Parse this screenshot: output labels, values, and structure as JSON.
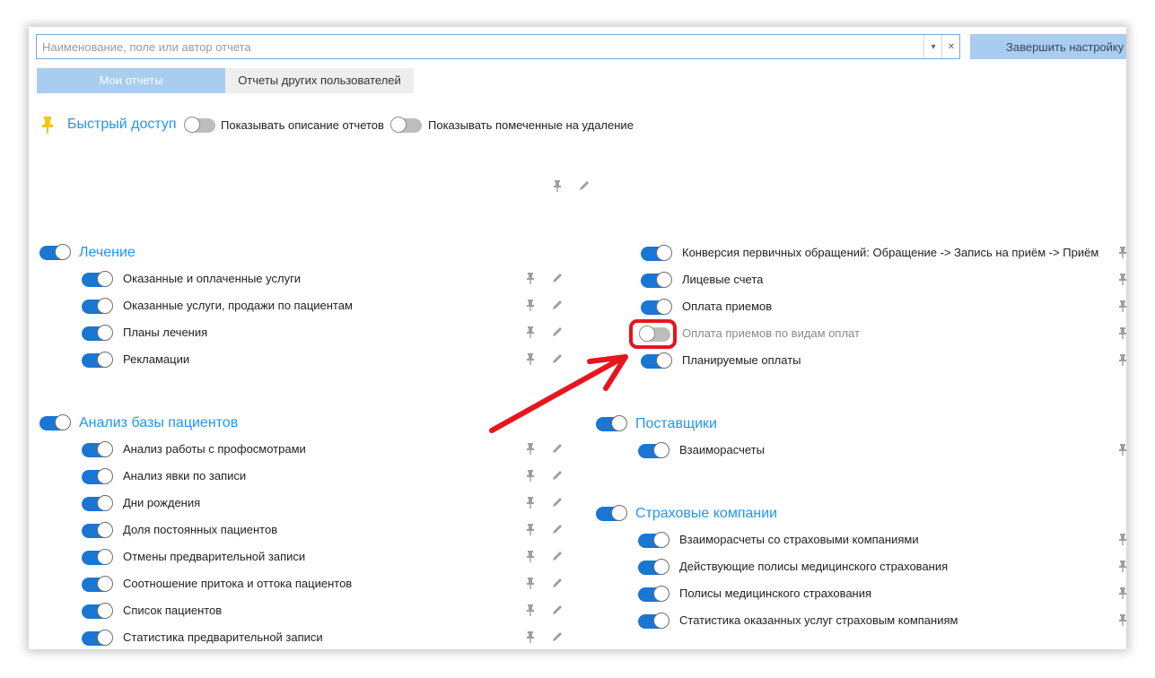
{
  "search": {
    "placeholder": "Наименование, поле или автор отчета",
    "value": ""
  },
  "header": {
    "finish_label": "Завершить настройку"
  },
  "tabs": [
    {
      "label": "Мои отчеты",
      "active": true
    },
    {
      "label": "Отчеты других пользователей",
      "active": false
    }
  ],
  "quick_access": {
    "title": "Быстрый доступ",
    "show_descriptions_label": "Показывать описание отчетов",
    "show_descriptions_on": false,
    "show_deleted_label": "Показывать помеченные на удаление",
    "show_deleted_on": false
  },
  "sections": {
    "lechenie": {
      "title": "Лечение",
      "items": [
        {
          "label": "Оказанные и оплаченные услуги",
          "on": true
        },
        {
          "label": "Оказанные услуги, продажи по пациентам",
          "on": true
        },
        {
          "label": "Планы лечения",
          "on": true
        },
        {
          "label": "Рекламации",
          "on": true
        }
      ]
    },
    "analiz": {
      "title": "Анализ базы пациентов",
      "items": [
        {
          "label": "Анализ работы с профосмотрами",
          "on": true
        },
        {
          "label": "Анализ явки по записи",
          "on": true
        },
        {
          "label": "Дни рождения",
          "on": true
        },
        {
          "label": "Доля постоянных пациентов",
          "on": true
        },
        {
          "label": "Отмены предварительной записи",
          "on": true
        },
        {
          "label": "Соотношение притока и оттока пациентов",
          "on": true
        },
        {
          "label": "Список пациентов",
          "on": true
        },
        {
          "label": "Статистика предварительной записи",
          "on": true
        }
      ]
    },
    "finance": {
      "items": [
        {
          "label": "Конверсия первичных обращений:  Обращение -> Запись на приём -> Приём",
          "on": true
        },
        {
          "label": "Лицевые счета",
          "on": true
        },
        {
          "label": "Оплата приемов",
          "on": true
        },
        {
          "label": "Оплата приемов по видам оплат",
          "on": false
        },
        {
          "label": "Планируемые оплаты",
          "on": true
        }
      ]
    },
    "postavshiki": {
      "title": "Поставщики",
      "items": [
        {
          "label": "Взаиморасчеты",
          "on": true
        }
      ]
    },
    "strahovye": {
      "title": "Страховые компании",
      "items": [
        {
          "label": "Взаиморасчеты со страховыми компаниями",
          "on": true
        },
        {
          "label": "Действующие полисы медицинского страхования",
          "on": true
        },
        {
          "label": "Полисы медицинского страхования",
          "on": true
        },
        {
          "label": "Статистика оказанных услуг страховым компаниям",
          "on": true
        }
      ]
    }
  },
  "icons": {
    "pin": "pin-icon",
    "edit": "pencil-icon",
    "quick_access": "yellow-pin-icon"
  },
  "colors": {
    "accent": "#2196f3",
    "toggle_on": "#1976d2",
    "annotation": "#e8141e",
    "pin_yellow": "#f5c518"
  }
}
